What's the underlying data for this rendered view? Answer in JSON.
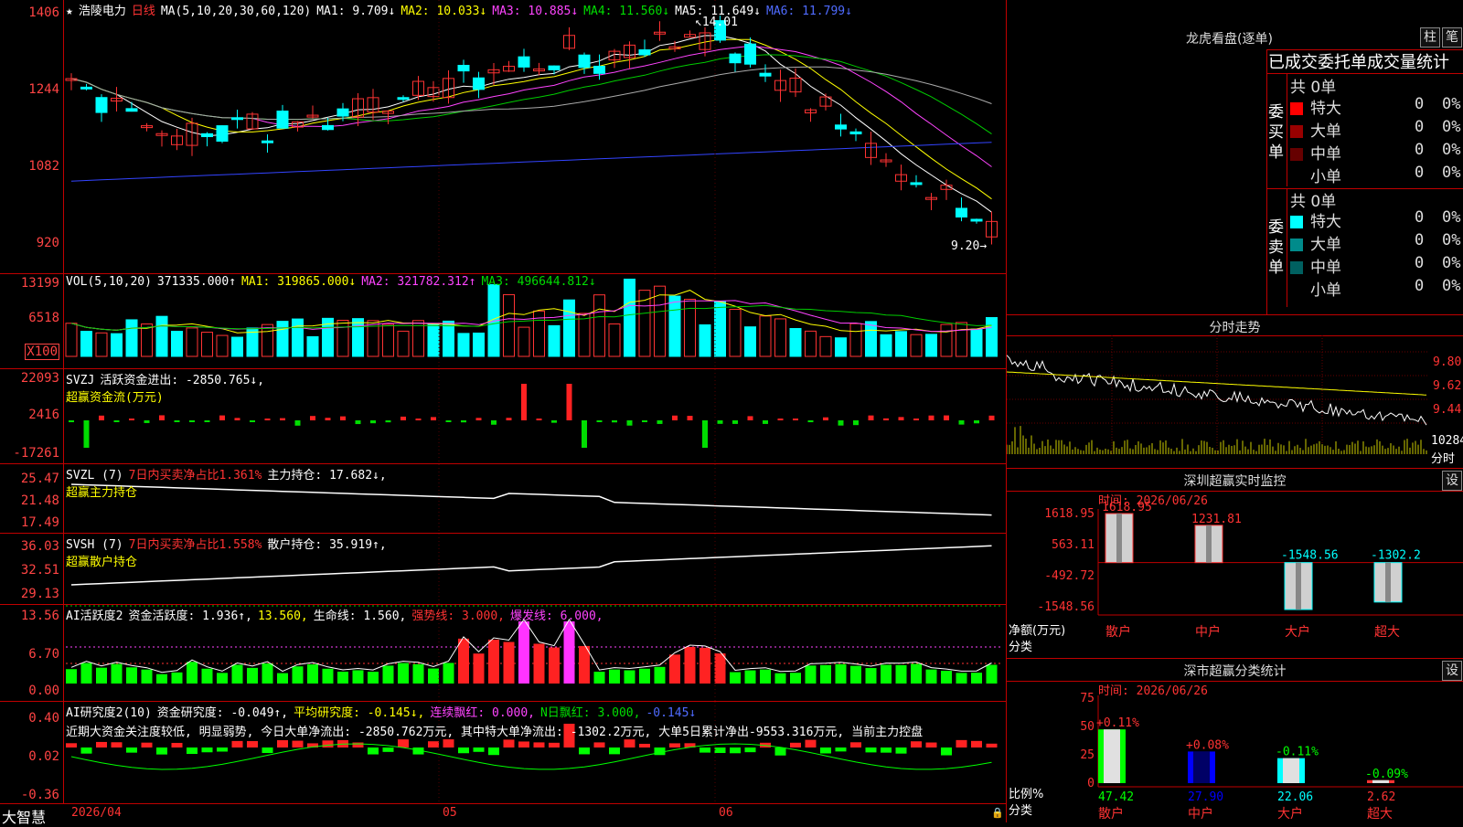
{
  "app": {
    "name": "大智慧"
  },
  "stock": {
    "name": "浩陵电力",
    "period": "日线"
  },
  "price_axis": {
    "ticks": [
      "1406",
      "1244",
      "1082",
      "920"
    ]
  },
  "ma_legend": {
    "label": "MA(5,10,20,30,60,120)",
    "ma1": "MA1: 9.709↓",
    "ma2": "MA2: 10.033↓",
    "ma3": "MA3: 10.885↓",
    "ma4": "MA4: 11.560↓",
    "ma5": "MA5: 11.649↓",
    "ma6": "MA6: 11.799↓"
  },
  "price_annotations": {
    "high": "14.01",
    "low": "9.20"
  },
  "vol": {
    "label": "VOL(5,10,20)",
    "value": "371335.000↑",
    "ma1": "MA1: 319865.000↓",
    "ma2": "MA2: 321782.312↑",
    "ma3": "MA3: 496644.812↓",
    "ticks": [
      "13199",
      "6518"
    ],
    "unit": "X100"
  },
  "svzj": {
    "label": "SVZJ",
    "line1": "活跃资金进出: -2850.765↓,",
    "line2": "超赢资金流(万元)",
    "ticks": [
      "22093",
      "2416",
      "-17261"
    ]
  },
  "svzl": {
    "label": "SVZL (7)",
    "ratio": "7日内买卖净占比1.361%",
    "hold": "主力持仓: 17.682↓,",
    "line2": "超赢主力持仓",
    "ticks": [
      "25.47",
      "21.48",
      "17.49"
    ]
  },
  "svsh": {
    "label": "SVSH (7)",
    "ratio": "7日内买卖净占比1.558%",
    "hold": "散户持仓: 35.919↑,",
    "line2": "超赢散户持仓",
    "ticks": [
      "36.03",
      "32.51",
      "29.13"
    ]
  },
  "ai1": {
    "label": "AI活跃度2",
    "v1": "资金活跃度: 1.936↑,",
    "v2": "13.560,",
    "v3": "生命线: 1.560,",
    "v4": "强势线: 3.000,",
    "v5": "爆发线: 6.000,",
    "ticks": [
      "13.56",
      "6.70",
      "0.00"
    ]
  },
  "ai2": {
    "label": "AI研究度2(10)",
    "v1": "资金研究度: -0.049↑,",
    "v2": "平均研究度: -0.145↓,",
    "v3": "连续飘红: 0.000,",
    "v4": "N日飘红: 3.000,",
    "v5": "-0.145↓",
    "text": "近期大资金关注度较低, 明显弱势, 今日大单净流出: -2850.762万元, 其中特大单净流出: -1302.2万元, 大单5日累计净出-9553.316万元, 当前主力控盘",
    "ticks": [
      "0.40",
      "0.02",
      "-0.36"
    ]
  },
  "date_axis": {
    "labels": [
      "2026/04",
      "05",
      "06"
    ]
  },
  "lhkp": {
    "title": "龙虎看盘(逐单)",
    "btn_zhu": "柱",
    "btn_bi": "笔",
    "subtitle": "已成交委托单成交量统计",
    "buy_group": {
      "side_label": "委买单",
      "total": "共 0单",
      "rows": [
        {
          "name": "特大",
          "count": "0",
          "pct": "0%",
          "color": "#ff0000"
        },
        {
          "name": "大单",
          "count": "0",
          "pct": "0%",
          "color": "#990000"
        },
        {
          "name": "中单",
          "count": "0",
          "pct": "0%",
          "color": "#660000"
        },
        {
          "name": "小单",
          "count": "0",
          "pct": "0%",
          "color": ""
        }
      ]
    },
    "sell_group": {
      "side_label": "委卖单",
      "total": "共 0单",
      "rows": [
        {
          "name": "特大",
          "count": "0",
          "pct": "0%",
          "color": "#00ffff"
        },
        {
          "name": "大单",
          "count": "0",
          "pct": "0%",
          "color": "#008b8b"
        },
        {
          "name": "中单",
          "count": "0",
          "pct": "0%",
          "color": "#006060"
        },
        {
          "name": "小单",
          "count": "0",
          "pct": "0%",
          "color": ""
        }
      ]
    }
  },
  "intraday": {
    "title": "分时走势",
    "ticks": [
      "9.80",
      "9.62",
      "9.44"
    ],
    "vol_label": "10284",
    "vol_unit": "分时"
  },
  "sz_monitor": {
    "title": "深圳超赢实时监控",
    "btn": "设",
    "time": "时间: 2026/06/26",
    "ticks": [
      "1618.95",
      "563.11",
      "-492.72",
      "-1548.56"
    ],
    "y_label": "净额(万元)",
    "x_label": "分类",
    "bars": [
      {
        "cat": "散户",
        "label": "1618.95",
        "value": 1618.95
      },
      {
        "cat": "中户",
        "label": "1231.81",
        "value": 1231.81
      },
      {
        "cat": "大户",
        "label": "-1548.56",
        "value": -1548.56
      },
      {
        "cat": "超大",
        "label": "-1302.2",
        "value": -1302.2
      }
    ]
  },
  "sz_class": {
    "title": "深市超赢分类统计",
    "btn": "设",
    "time": "时间: 2026/06/26",
    "ticks": [
      "75",
      "50",
      "25",
      "0"
    ],
    "y_label": "比例%",
    "x_label": "分类",
    "bars": [
      {
        "cat": "散户",
        "value": 47.42,
        "bottom": "47.42",
        "top": "+0.11%"
      },
      {
        "cat": "中户",
        "value": 27.9,
        "bottom": "27.90",
        "top": "+0.08%"
      },
      {
        "cat": "大户",
        "value": 22.06,
        "bottom": "22.06",
        "top": "-0.11%"
      },
      {
        "cat": "超大",
        "value": 2.62,
        "bottom": "2.62",
        "top": "-0.09%"
      }
    ]
  },
  "chart_data": [
    {
      "type": "bar",
      "title": "深圳超赢实时监控",
      "categories": [
        "散户",
        "中户",
        "大户",
        "超大"
      ],
      "values": [
        1618.95,
        1231.81,
        -1548.56,
        -1302.2
      ],
      "ylabel": "净额(万元)",
      "xlabel": "分类",
      "ylim": [
        -1548.56,
        1618.95
      ]
    },
    {
      "type": "bar",
      "title": "深市超赢分类统计",
      "categories": [
        "散户",
        "中户",
        "大户",
        "超大"
      ],
      "values": [
        47.42,
        27.9,
        22.06,
        2.62
      ],
      "ylabel": "比例%",
      "xlabel": "分类",
      "ylim": [
        0,
        75
      ]
    }
  ]
}
